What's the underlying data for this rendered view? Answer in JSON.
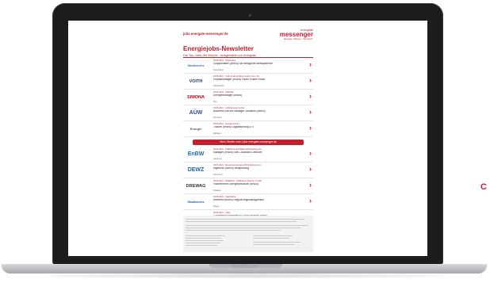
{
  "device": {
    "brand_label": "MacBook"
  },
  "page_edge_glyph": "C",
  "newsletter": {
    "url": "jobs.energate-messenger.de",
    "brand": {
      "top": "energate",
      "main": "messenger",
      "sub": "Energie. Wissen. Netzwerk."
    },
    "title": "Energiejobs-Newsletter",
    "subtitle": "Die Top-Jobs der Woche - ausgewählt von energate",
    "cta_label": "Mehr Stellen unter jobs.energate-messenger.de",
    "jobs_top": [
      {
        "logo": "Stadtwerke",
        "logo_color": "#4a7db5",
        "meta": "25.05.2021 · Stadtwerke",
        "title": "Gruppenleiter (w/m/d) für Intelligente Messsysteme",
        "loc": "Düsseldorf"
      },
      {
        "logo": "VOITH",
        "logo_color": "#1d3a6e",
        "meta": "25.05.2021 · Voith Hydro Holding GmbH & Co. KG",
        "title": "Projektmanager (m/w/d) Hydro Power Plants",
        "loc": "Heidenheim"
      },
      {
        "logo": "SIMONA",
        "logo_color": "#d0021b",
        "meta": "25.05.2021 · SIMONA",
        "title": "Energiemanager (m/w/d)",
        "loc": "Kirn"
      },
      {
        "logo": "AÜW",
        "logo_color": "#2a4fa0",
        "meta": "25.05.2021 · AÜW Energie GmbH",
        "title": "Business Service Manager Solutions (m/w/d)",
        "loc": "Kempten"
      },
      {
        "logo": "Energie",
        "logo_color": "#555555",
        "meta": "25.05.2021 · Energie GmbH",
        "title": "Trainee (m/w/d) Digitalisierung & IT",
        "loc": "Ettlingen"
      }
    ],
    "jobs_bottom": [
      {
        "logo": "EnBW",
        "logo_color": "#1c6db5",
        "meta": "25.05.2021 · EnBW Energie Baden-Württemberg AG",
        "title": "Manager (m/w/d) Site Conditions Offshore",
        "loc": "Hamburg"
      },
      {
        "logo": "DEWZ",
        "logo_color": "#1f5fa5",
        "meta": "25.05.2021 · Deutsches Energie-Wirtschaftszentrum",
        "title": "Ingenieur (m/w/d) Netzplanung",
        "loc": "Dortmund"
      },
      {
        "logo": "DREWAG",
        "logo_color": "#333333",
        "meta": "25.05.2021 · DREWAG · Stadtwerke Dresden GmbH",
        "title": "Fachreferent Energiewirtschaft (m/w/d)",
        "loc": "Dresden"
      },
      {
        "logo": "Stadtwerke",
        "logo_color": "#2d5fa0",
        "meta": "25.05.2021 · Stadtwerke",
        "title": "Referent (m/w/d) Regulierungsmanagement",
        "loc": "Essen"
      },
      {
        "logo": "Solar",
        "logo_color": "#e5a300",
        "meta": "25.05.2021 · Solar",
        "title": "Commercial Manager für Solar Projects (m/f/d)",
        "loc": "Mannheim"
      }
    ]
  }
}
